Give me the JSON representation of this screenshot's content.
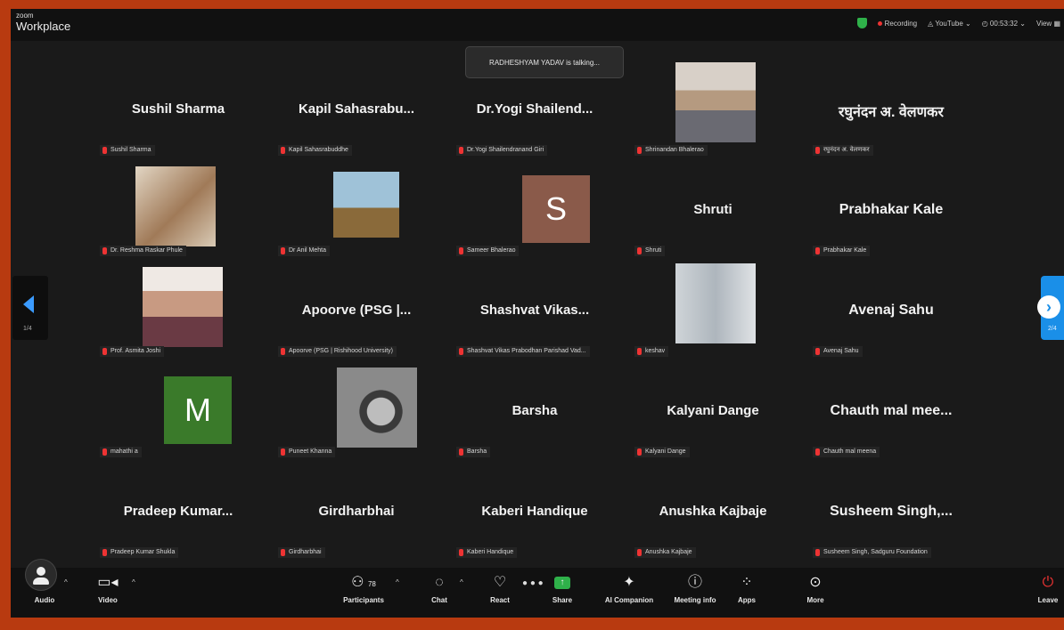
{
  "app": {
    "brand_small": "zoom",
    "brand": "Workplace"
  },
  "topbar": {
    "recording": "Recording",
    "stream": "YouTube",
    "timer": "00:53:32",
    "view": "View"
  },
  "talking": "RADHESHYAM YADAV is talking...",
  "pager": {
    "prev_label": "1/4",
    "next_label": "2/4"
  },
  "tiles": [
    {
      "name": "Sushil Sharma",
      "label": "Sushil Sharma"
    },
    {
      "name": "Kapil  Sahasrabu...",
      "label": "Kapil Sahasrabuddhe"
    },
    {
      "name": "Dr.Yogi  Shailend...",
      "label": "Dr.Yogi Shailendranand Giri"
    },
    {
      "name": "",
      "label": "Shrinandan Bhalerao"
    },
    {
      "name": "रघुनंदन अ. वेलणकर",
      "label": "रघुनंदन अ. वेलणकर"
    },
    {
      "name": "",
      "label": "Dr. Reshma Raskar Phule"
    },
    {
      "name": "",
      "label": "Dr Anil Mehta"
    },
    {
      "name": "",
      "label": "Sameer Bhalerao",
      "letter": "S"
    },
    {
      "name": "Shruti",
      "label": "Shruti"
    },
    {
      "name": "Prabhakar Kale",
      "label": "Prabhakar Kale"
    },
    {
      "name": "",
      "label": "Prof. Asmita Joshi"
    },
    {
      "name": "Apoorve  (PSG  |...",
      "label": "Apoorve (PSG | Rishihood University)"
    },
    {
      "name": "Shashvat  Vikas...",
      "label": "Shashvat Vikas Prabodhan Parishad Vad..."
    },
    {
      "name": "",
      "label": "keshav"
    },
    {
      "name": "Avenaj Sahu",
      "label": "Avenaj Sahu"
    },
    {
      "name": "",
      "label": "mahathi a",
      "letter": "M"
    },
    {
      "name": "",
      "label": "Puneet Khanna"
    },
    {
      "name": "Barsha",
      "label": "Barsha"
    },
    {
      "name": "Kalyani Dange",
      "label": "Kalyani Dange"
    },
    {
      "name": "Chauth mal mee...",
      "label": "Chauth mal meena"
    },
    {
      "name": "Pradeep  Kumar...",
      "label": "Pradeep Kumar Shukla"
    },
    {
      "name": "Girdharbhai",
      "label": "Girdharbhai"
    },
    {
      "name": "Kaberi Handique",
      "label": "Kaberi Handique"
    },
    {
      "name": "Anushka Kajbaje",
      "label": "Anushka Kajbaje"
    },
    {
      "name": "Susheem  Singh,...",
      "label": "Susheem Singh, Sadguru Foundation"
    }
  ],
  "toolbar": {
    "audio": "Audio",
    "video": "Video",
    "participants": "Participants",
    "participants_count": "78",
    "chat": "Chat",
    "react": "React",
    "share": "Share",
    "ai": "AI Companion",
    "meeting_info": "Meeting info",
    "apps": "Apps",
    "more": "More",
    "leave": "Leave"
  },
  "colors": {
    "accent": "#1a8fe8",
    "letter_s": "#8a5a4a",
    "letter_m": "#3a7a2a",
    "frame": "#b83a10"
  }
}
